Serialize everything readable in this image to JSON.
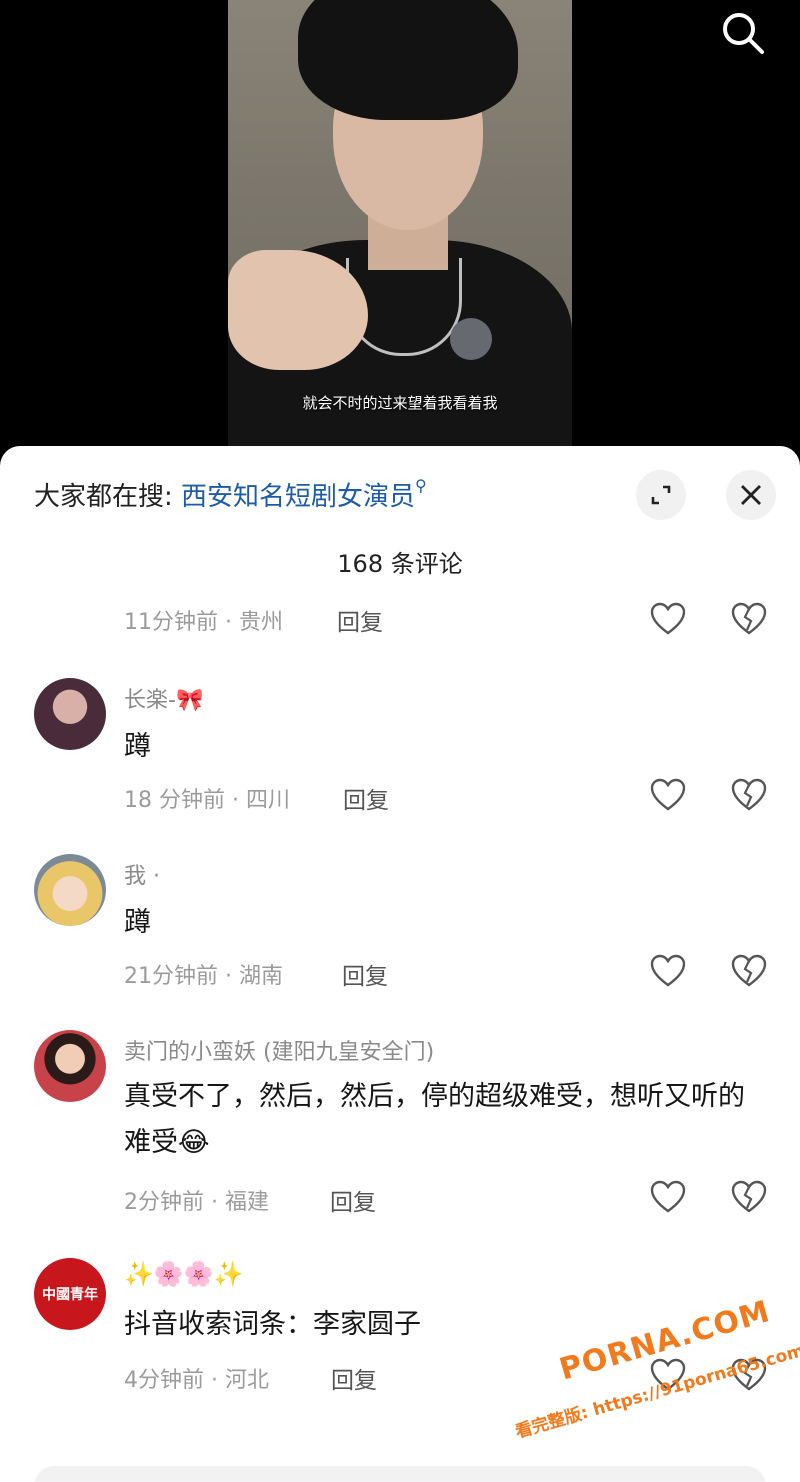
{
  "video": {
    "subtitle": "就会不时的过来望着我看着我"
  },
  "comment_panel": {
    "hot_search_prefix": "大家都在搜:",
    "hot_search_term": "西安知名短剧女演员",
    "comment_count": "168 条评论",
    "reply_label": "回复"
  },
  "comments": [
    {
      "time_location": "11分钟前 · 贵州"
    },
    {
      "username": "长楽-🎀",
      "text": "蹲",
      "time_location": "18 分钟前 · 四川"
    },
    {
      "username": "我 ·",
      "text": "蹲",
      "time_location": "21分钟前 · 湖南"
    },
    {
      "username": "卖门的小蛮妖 (建阳九皇安全门)",
      "text": "真受不了，然后，然后，停的超级难受，想听又听的难受😂",
      "time_location": "2分钟前 · 福建"
    },
    {
      "username": "✨🌸🌸✨",
      "text": "抖音收索词条：李家圆子",
      "time_location": "4分钟前 · 河北",
      "avatar_text": "中國青年"
    }
  ],
  "watermark": {
    "site": "PORNA.COM",
    "url": "看完整版: https://91porna65.com"
  },
  "colors": {
    "link_blue": "#1d5ca8",
    "watermark_orange": "#f07a1c"
  }
}
